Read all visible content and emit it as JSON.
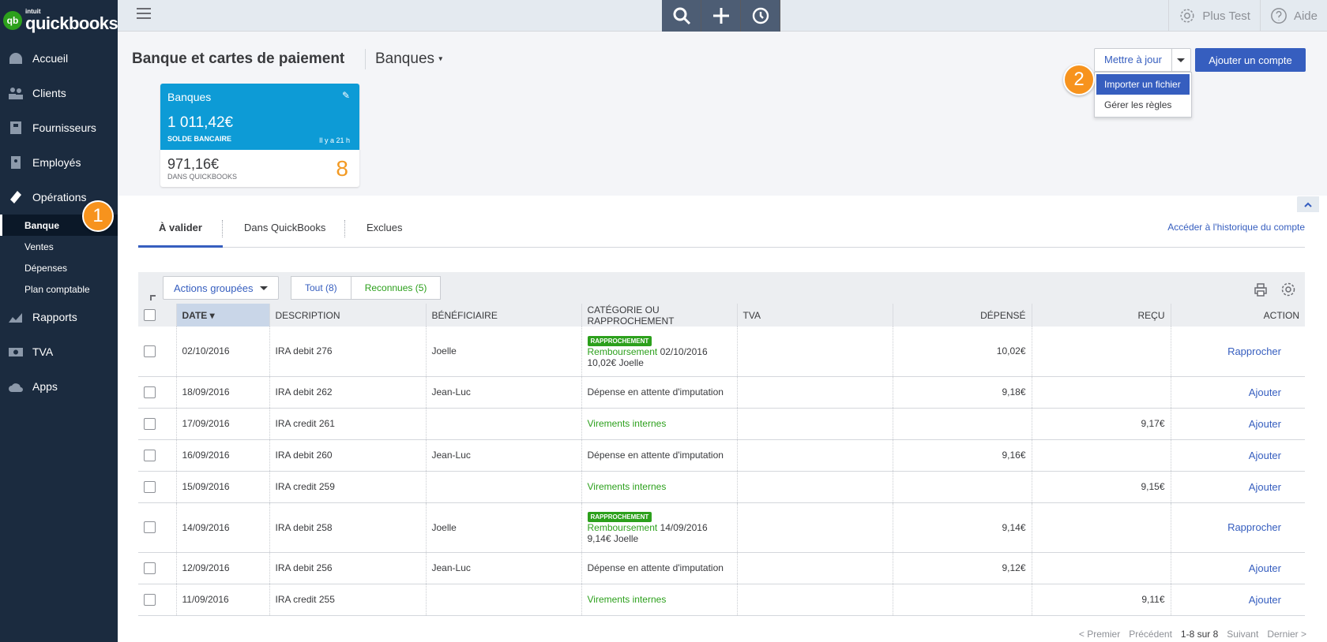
{
  "brand": {
    "badge": "qb",
    "small": "intuit",
    "name": "quickbooks."
  },
  "sidebar": {
    "items": [
      {
        "label": "Accueil",
        "icon": "dashboard-icon"
      },
      {
        "label": "Clients",
        "icon": "customers-icon"
      },
      {
        "label": "Fournisseurs",
        "icon": "suppliers-icon"
      },
      {
        "label": "Employés",
        "icon": "employees-icon"
      },
      {
        "label": "Opérations",
        "icon": "operations-icon"
      }
    ],
    "sub": [
      "Banque",
      "Ventes",
      "Dépenses",
      "Plan comptable"
    ],
    "items2": [
      {
        "label": "Rapports",
        "icon": "reports-icon"
      },
      {
        "label": "TVA",
        "icon": "vat-icon"
      },
      {
        "label": "Apps",
        "icon": "apps-icon"
      }
    ]
  },
  "callouts": {
    "one": "1",
    "two": "2"
  },
  "topbar": {
    "user": "Plus Test",
    "help": "Aide"
  },
  "page": {
    "title": "Banque et cartes de paiement",
    "account": "Banques"
  },
  "card": {
    "name": "Banques",
    "balance": "1 011,42€",
    "balance_label": "SOLDE BANCAIRE",
    "time": "Il y a 21 h",
    "qb_amount": "971,16€",
    "qb_label": "DANS QUICKBOOKS",
    "count": "8"
  },
  "actions": {
    "update": "Mettre à jour",
    "add": "Ajouter un compte",
    "menu": [
      "Importer un fichier",
      "Gérer les règles"
    ]
  },
  "tabs": {
    "items": [
      "À valider",
      "Dans QuickBooks",
      "Exclues"
    ],
    "history": "Accéder à l'historique du compte"
  },
  "toolbar": {
    "group": "Actions groupées",
    "all": "Tout (8)",
    "recognized": "Reconnues (5)"
  },
  "table": {
    "headers": [
      "DATE ▾",
      "DESCRIPTION",
      "BÉNÉFICIAIRE",
      "CATÉGORIE OU RAPPROCHEMENT",
      "TVA",
      "DÉPENSÉ",
      "REÇU",
      "ACTION"
    ],
    "rows": [
      {
        "date": "02/10/2016",
        "desc": "IRA debit 276",
        "payee": "Joelle",
        "tag": "RAPPROCHEMENT",
        "cat_link": "Remboursement",
        "cat_rest": "02/10/2016",
        "cat_line2": "10,02€ Joelle",
        "spent": "10,02€",
        "recv": "",
        "action": "Rapprocher"
      },
      {
        "date": "18/09/2016",
        "desc": "IRA debit 262",
        "payee": "Jean-Luc",
        "cat": "Dépense en attente d'imputation",
        "spent": "9,18€",
        "recv": "",
        "action": "Ajouter"
      },
      {
        "date": "17/09/2016",
        "desc": "IRA credit 261",
        "payee": "",
        "cat_green": "Virements internes",
        "spent": "",
        "recv": "9,17€",
        "action": "Ajouter"
      },
      {
        "date": "16/09/2016",
        "desc": "IRA debit 260",
        "payee": "Jean-Luc",
        "cat": "Dépense en attente d'imputation",
        "spent": "9,16€",
        "recv": "",
        "action": "Ajouter"
      },
      {
        "date": "15/09/2016",
        "desc": "IRA credit 259",
        "payee": "",
        "cat_green": "Virements internes",
        "spent": "",
        "recv": "9,15€",
        "action": "Ajouter"
      },
      {
        "date": "14/09/2016",
        "desc": "IRA debit 258",
        "payee": "Joelle",
        "tag": "RAPPROCHEMENT",
        "cat_link": "Remboursement",
        "cat_rest": "14/09/2016",
        "cat_line2": "9,14€ Joelle",
        "spent": "9,14€",
        "recv": "",
        "action": "Rapprocher"
      },
      {
        "date": "12/09/2016",
        "desc": "IRA debit 256",
        "payee": "Jean-Luc",
        "cat": "Dépense en attente d'imputation",
        "spent": "9,12€",
        "recv": "",
        "action": "Ajouter"
      },
      {
        "date": "11/09/2016",
        "desc": "IRA credit 255",
        "payee": "",
        "cat_green": "Virements internes",
        "spent": "",
        "recv": "9,11€",
        "action": "Ajouter"
      }
    ]
  },
  "pager": {
    "first": "< Premier",
    "prev": "Précédent",
    "range": "1-8 sur 8",
    "next": "Suivant",
    "last": "Dernier >"
  }
}
